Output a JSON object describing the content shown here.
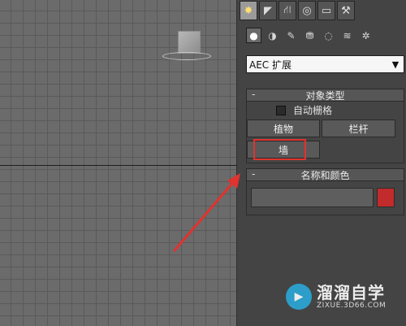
{
  "tabs": [
    {
      "icon": "create-icon",
      "glyph": "✸"
    },
    {
      "icon": "modify-icon",
      "glyph": "◤"
    },
    {
      "icon": "hierarchy-icon",
      "glyph": "⛙"
    },
    {
      "icon": "motion-icon",
      "glyph": "◎"
    },
    {
      "icon": "display-icon",
      "glyph": "▭"
    },
    {
      "icon": "utilities-icon",
      "glyph": "⚒"
    }
  ],
  "subcategories": [
    {
      "icon": "geometry-icon",
      "glyph": "●"
    },
    {
      "icon": "shapes-icon",
      "glyph": "◑"
    },
    {
      "icon": "lights-icon",
      "glyph": "✎"
    },
    {
      "icon": "cameras-icon",
      "glyph": "⛃"
    },
    {
      "icon": "helpers-icon",
      "glyph": "◌"
    },
    {
      "icon": "space-warps-icon",
      "glyph": "≋"
    },
    {
      "icon": "systems-icon",
      "glyph": "✲"
    }
  ],
  "category_dropdown": {
    "value": "AEC 扩展"
  },
  "object_type": {
    "title": "对象类型",
    "collapse": "-",
    "autogrid_label": "自动栅格",
    "buttons": {
      "foliage": "植物",
      "railing": "栏杆",
      "wall": "墙"
    }
  },
  "name_color": {
    "title": "名称和颜色",
    "collapse": "-",
    "name_value": "",
    "swatch_color": "#c22b2b"
  },
  "watermark": {
    "title": "溜溜自学",
    "url": "ZIXUE.3D66.COM"
  },
  "colors": {
    "highlight": "#e0332f",
    "arrow": "#e0332f"
  }
}
